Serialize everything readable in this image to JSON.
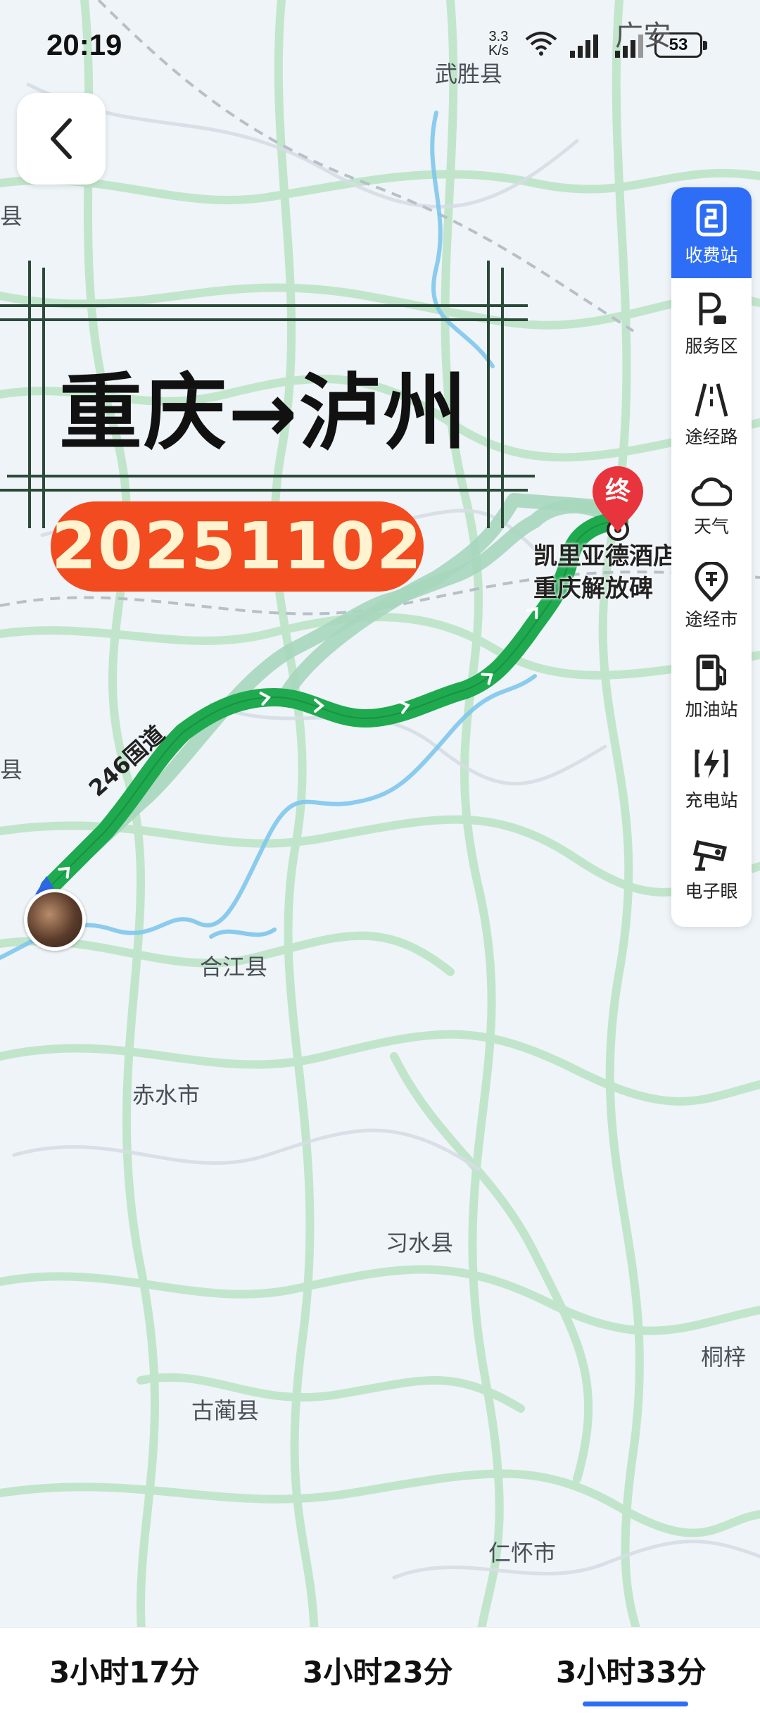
{
  "status": {
    "time": "20:19",
    "speed": "3.3",
    "speed_unit": "K/s",
    "battery": "53"
  },
  "title": {
    "text": "重庆→泸州",
    "date": "20251102"
  },
  "map": {
    "place_labels": [
      "武胜县",
      "岳县",
      "广安",
      "泸县",
      "合江县",
      "赤水市",
      "习水县",
      "古蔺县",
      "仁怀市",
      "桐梓"
    ],
    "destination": {
      "pin_label": "终",
      "name_line1": "凯里亚德酒店",
      "name_line2": "重庆解放碑"
    },
    "route_road": "246国道"
  },
  "sidebar": {
    "items": [
      {
        "label": "收费站",
        "icon": "toll-station-icon"
      },
      {
        "label": "服务区",
        "icon": "service-area-icon"
      },
      {
        "label": "途经路",
        "icon": "road-icon"
      },
      {
        "label": "天气",
        "icon": "weather-cloud-icon"
      },
      {
        "label": "途经市",
        "icon": "city-pin-icon"
      },
      {
        "label": "加油站",
        "icon": "gas-station-icon"
      },
      {
        "label": "充电站",
        "icon": "charging-station-icon"
      },
      {
        "label": "电子眼",
        "icon": "camera-icon"
      }
    ],
    "active_index": 0
  },
  "route_options": [
    {
      "label": "3小时17分"
    },
    {
      "label": "3小时23分"
    },
    {
      "label": "3小时33分",
      "selected": true
    }
  ],
  "colors": {
    "route_primary": "#1faa4f",
    "route_alt": "#a6d6bc",
    "accent": "#2e6ef6",
    "date_pill": "#f24b1f",
    "pin": "#e8343c"
  }
}
